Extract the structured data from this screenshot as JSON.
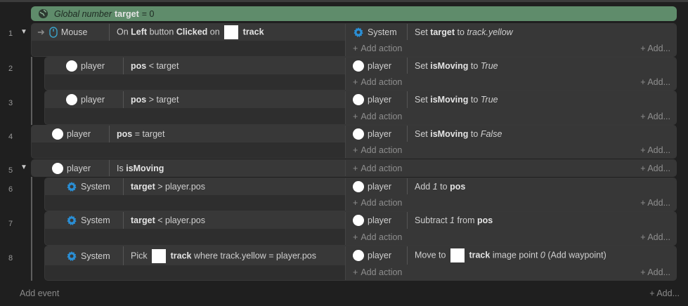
{
  "global_var": {
    "prefix": "Global number",
    "name": "target",
    "value": "= 0"
  },
  "rows": [
    "1",
    "2",
    "3",
    "4",
    "5",
    "6",
    "7",
    "8"
  ],
  "labels": {
    "add_action": "Add action",
    "add_right": "Add...",
    "add_event": "Add event",
    "plus": "+"
  },
  "objects": {
    "mouse": "Mouse",
    "system": "System",
    "player": "player"
  },
  "e1": {
    "c_on": "On",
    "c_left": "Left",
    "c_button": "button",
    "c_clicked": "Clicked",
    "c_on2": "on",
    "c_track": "track",
    "a_set": "Set",
    "a_target": "target",
    "a_to": "to",
    "a_val": "track.yellow"
  },
  "e2": {
    "c_pos": "pos",
    "c_op": "< target",
    "a_set": "Set",
    "a_var": "isMoving",
    "a_to": "to",
    "a_val": "True"
  },
  "e3": {
    "c_pos": "pos",
    "c_op": "> target",
    "a_set": "Set",
    "a_var": "isMoving",
    "a_to": "to",
    "a_val": "True"
  },
  "e4": {
    "c_pos": "pos",
    "c_op": "= target",
    "a_set": "Set",
    "a_var": "isMoving",
    "a_to": "to",
    "a_val": "False"
  },
  "e5": {
    "c_is": "Is",
    "c_var": "isMoving"
  },
  "e6": {
    "c_target": "target",
    "c_op": "> player.pos",
    "a_add": "Add",
    "a_num": "1",
    "a_to": "to",
    "a_var": "pos"
  },
  "e7": {
    "c_target": "target",
    "c_op": "< player.pos",
    "a_sub": "Subtract",
    "a_num": "1",
    "a_from": "from",
    "a_var": "pos"
  },
  "e8": {
    "c_pick": "Pick",
    "c_track": "track",
    "c_rest": "where track.yellow = player.pos",
    "a_move": "Move to",
    "a_track": "track",
    "a_image": "image point",
    "a_num": "0",
    "a_rest": "(Add waypoint)"
  },
  "colors": {
    "global_bar": "#5f8c6b",
    "gear": "#2a8fd6",
    "mouse": "#3aa3c9"
  }
}
